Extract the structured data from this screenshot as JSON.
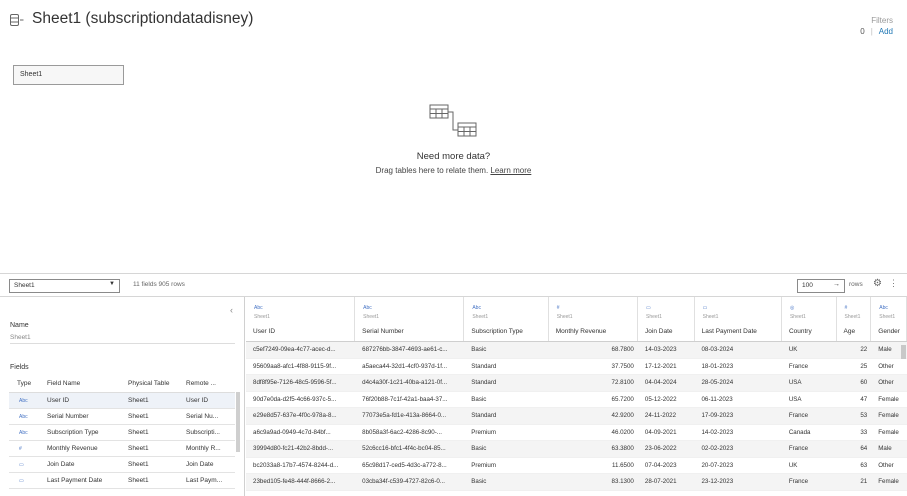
{
  "header": {
    "title": "Sheet1 (subscriptiondatadisney)",
    "filters_label": "Filters",
    "filters_count": "0",
    "filters_sep": "|",
    "filters_add": "Add"
  },
  "canvas": {
    "sheet_box_label": "Sheet1",
    "need_more": "Need more data?",
    "drag_text": "Drag tables here to relate them.",
    "learn_more": "Learn more"
  },
  "toolbar": {
    "table_select": "Sheet1",
    "info": "11 fields 905 rows",
    "rows_value": "100",
    "rows_label": "rows"
  },
  "meta": {
    "name_label": "Name",
    "name_value": "Sheet1",
    "fields_label": "Fields",
    "headers": {
      "type": "Type",
      "field_name": "Field Name",
      "physical": "Physical Table",
      "remote": "Remote ..."
    },
    "fields": [
      {
        "type": "Abc",
        "name": "User ID",
        "physical": "Sheet1",
        "remote": "User ID"
      },
      {
        "type": "Abc",
        "name": "Serial Number",
        "physical": "Sheet1",
        "remote": "Serial Nu..."
      },
      {
        "type": "Abc",
        "name": "Subscription Type",
        "physical": "Sheet1",
        "remote": "Subscripti..."
      },
      {
        "type": "#",
        "name": "Monthly Revenue",
        "physical": "Sheet1",
        "remote": "Monthly R..."
      },
      {
        "type": "▭",
        "name": "Join Date",
        "physical": "Sheet1",
        "remote": "Join Date"
      },
      {
        "type": "▭",
        "name": "Last Payment Date",
        "physical": "Sheet1",
        "remote": "Last Paym..."
      }
    ]
  },
  "grid": {
    "columns": [
      {
        "type": "Abc",
        "source": "Sheet1",
        "name": "User ID"
      },
      {
        "type": "Abc",
        "source": "Sheet1",
        "name": "Serial Number"
      },
      {
        "type": "Abc",
        "source": "Sheet1",
        "name": "Subscription Type"
      },
      {
        "type": "#",
        "source": "Sheet1",
        "name": "Monthly Revenue"
      },
      {
        "type": "▭",
        "source": "Sheet1",
        "name": "Join Date"
      },
      {
        "type": "▭",
        "source": "Sheet1",
        "name": "Last Payment Date"
      },
      {
        "type": "◎",
        "source": "Sheet1",
        "name": "Country"
      },
      {
        "type": "#",
        "source": "Sheet1",
        "name": "Age"
      },
      {
        "type": "Abc",
        "source": "Sheet1",
        "name": "Gender"
      }
    ],
    "rows": [
      [
        "c5ef7249-09ea-4c77-acec-d...",
        "687276bb-3847-4693-ae61-c...",
        "Basic",
        "68.7800",
        "14-03-2023",
        "08-03-2024",
        "UK",
        "22",
        "Male"
      ],
      [
        "95609aa8-afc1-4f88-9115-9f...",
        "a5aeca44-32d1-4cf0-937d-1f...",
        "Standard",
        "37.7500",
        "17-12-2021",
        "18-01-2023",
        "France",
        "25",
        "Other"
      ],
      [
        "8df8f95e-7126-48c5-9596-5f...",
        "d4c4a30f-1c21-40ba-a121-0f...",
        "Standard",
        "72.8100",
        "04-04-2024",
        "28-05-2024",
        "USA",
        "60",
        "Other"
      ],
      [
        "90d7e0da-d2f5-4c66-937c-5...",
        "76f20b88-7c1f-42a1-baa4-37...",
        "Basic",
        "65.7200",
        "05-12-2022",
        "06-11-2023",
        "USA",
        "47",
        "Female"
      ],
      [
        "e29e8d57-637e-4f0c-978a-8...",
        "77073e5a-fd1e-413a-8664-0...",
        "Standard",
        "42.9200",
        "24-11-2022",
        "17-09-2023",
        "France",
        "53",
        "Female"
      ],
      [
        "a6c9a9ad-0949-4c7d-84bf...",
        "8b058a3f-6ac2-4286-8c90-...",
        "Premium",
        "46.0200",
        "04-09-2021",
        "14-02-2023",
        "Canada",
        "33",
        "Female"
      ],
      [
        "39994d80-fc21-42b2-8bdd-...",
        "52c6cc16-bfc1-4f4c-bc04-85...",
        "Basic",
        "63.3800",
        "23-06-2022",
        "02-02-2023",
        "France",
        "64",
        "Male"
      ],
      [
        "bc2033a8-17b7-4574-8244-d...",
        "65c98d17-ced5-4d3c-a772-8...",
        "Premium",
        "11.6500",
        "07-04-2023",
        "20-07-2023",
        "UK",
        "63",
        "Other"
      ],
      [
        "23bed105-fe48-444f-8666-2...",
        "03cba34f-c539-4727-82c6-0...",
        "Basic",
        "83.1300",
        "28-07-2021",
        "23-12-2023",
        "France",
        "21",
        "Female"
      ]
    ]
  }
}
